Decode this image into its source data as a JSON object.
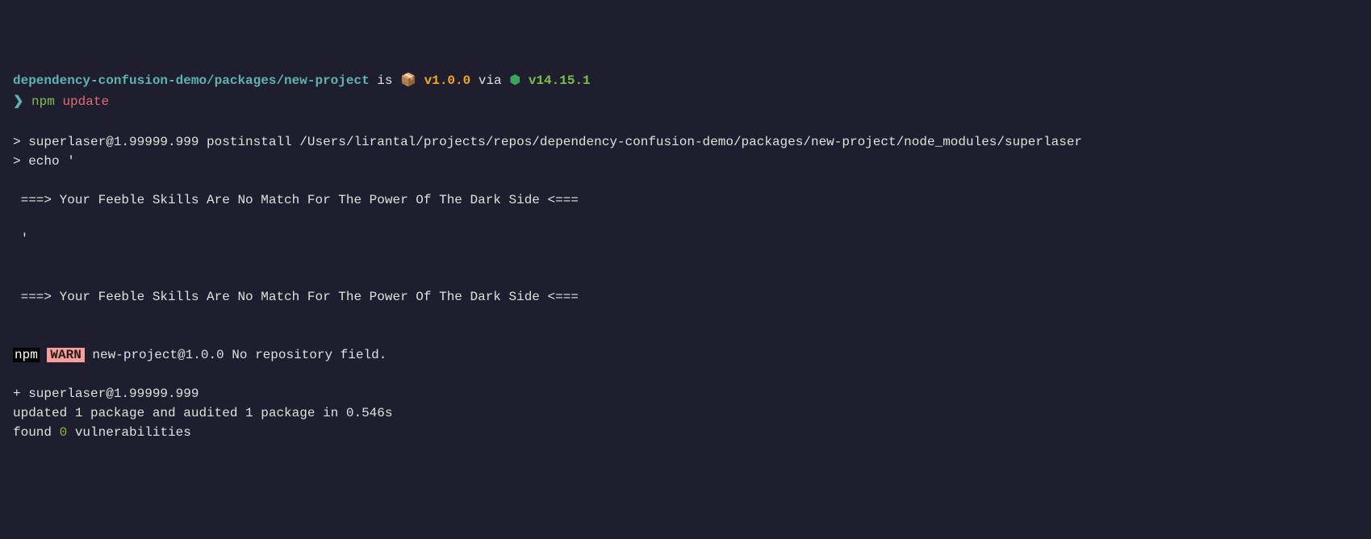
{
  "prompt": {
    "path": "dependency-confusion-demo/packages/new-project",
    "is_word": "is",
    "package_icon": "📦",
    "version": "v1.0.0",
    "via_word": "via",
    "hex_icon": "⬢",
    "node_version": "v14.15.1",
    "prompt_symbol": "❯",
    "command_name": "npm",
    "command_arg": "update"
  },
  "output": {
    "line1": "> superlaser@1.99999.999 postinstall /Users/lirantal/projects/repos/dependency-confusion-demo/packages/new-project/node_modules/superlaser",
    "line2": "> echo '",
    "dark_side_msg": " ===> Your Feeble Skills Are No Match For The Power Of The Dark Side <===",
    "close_quote": " '",
    "npm_label": "npm",
    "warn_label": "WARN",
    "warn_msg": " new-project@1.0.0 No repository field.",
    "added_line": "+ superlaser@1.99999.999",
    "updated_line": "updated 1 package and audited 1 package in 0.546s",
    "found_prefix": "found ",
    "found_zero": "0",
    "found_suffix": " vulnerabilities"
  }
}
